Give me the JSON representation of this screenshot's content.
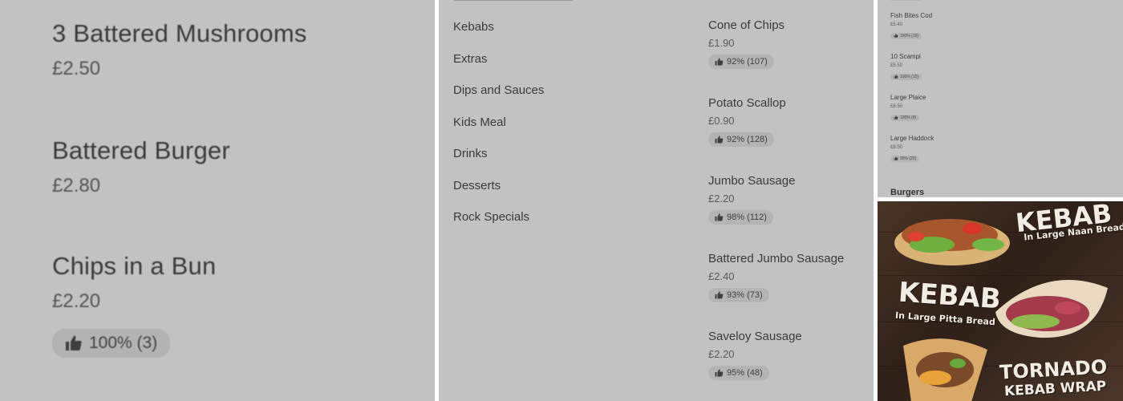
{
  "panel_large": {
    "items": [
      {
        "name": "3 Battered Mushrooms",
        "price": "£2.50"
      },
      {
        "name": "Battered Burger",
        "price": "£2.80"
      },
      {
        "name": "Chips in a Bun",
        "price": "£2.20",
        "rating": "100% (3)"
      }
    ]
  },
  "panel_menu": {
    "categories": [
      "Kebabs",
      "Extras",
      "Dips and Sauces",
      "Kids Meal",
      "Drinks",
      "Desserts",
      "Rock Specials"
    ],
    "items": [
      {
        "name": "Cone of Chips",
        "price": "£1.90",
        "rating": "92% (107)"
      },
      {
        "name": "Potato Scallop",
        "price": "£0.90",
        "rating": "92% (128)"
      },
      {
        "name": "Jumbo Sausage",
        "price": "£2.20",
        "rating": "98% (112)"
      },
      {
        "name": "Battered Jumbo Sausage",
        "price": "£2.40",
        "rating": "93% (73)"
      },
      {
        "name": "Saveloy Sausage",
        "price": "£2.20",
        "rating": "95% (48)"
      }
    ]
  },
  "panel_small": {
    "items": [
      {
        "name": "Fish Bites Cod",
        "price": "£5.40",
        "rating": "100% (19)"
      },
      {
        "name": "10 Scampi",
        "price": "£5.50",
        "rating": "100% (15)"
      },
      {
        "name": "Large Plaice",
        "price": "£8.50",
        "rating": "100% (8)"
      },
      {
        "name": "Large Haddock",
        "price": "£8.50",
        "rating": "95% (20)"
      }
    ],
    "section_heading": "Burgers"
  },
  "poster": {
    "kebab_naan_title": "KEBAB",
    "kebab_naan_subtitle": "In Large Naan Bread",
    "kebab_pitta_title": "KEBAB",
    "kebab_pitta_subtitle": "In Large Pitta Bread",
    "tornado_line1": "TORNADO",
    "tornado_line2": "KEBAB WRAP"
  },
  "icons": {
    "rating": "thumbs-up-icon"
  },
  "colors": {
    "panel_bg": "#c2c2c2",
    "badge_bg": "#b4b4b4",
    "text": "#3b3b3b",
    "poster_text": "#f1ece4"
  }
}
